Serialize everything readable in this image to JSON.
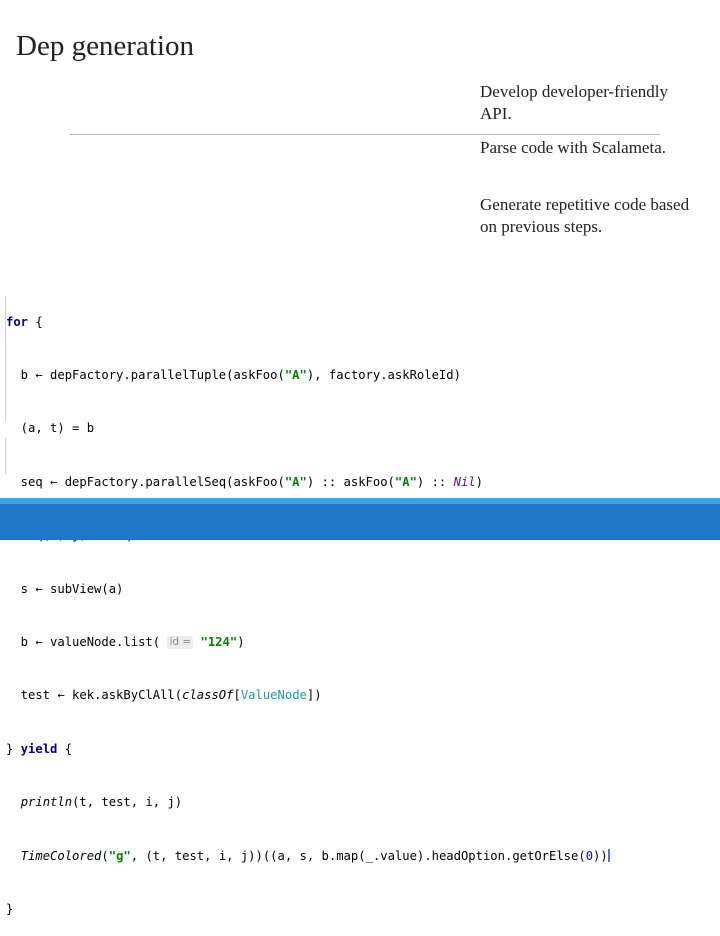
{
  "slide": {
    "title": "Dep generation",
    "bullets": [
      "Develop developer-friendly API.",
      "Parse code with Scalameta.",
      "Generate repetitive code based on previous steps."
    ]
  },
  "code": {
    "inlay_hint": "id =",
    "lines": [
      "for {",
      "  b ← depFactory.parallelTuple(askFoo(\"A\"), factory.askRoleId)",
      "  (a, t) = b",
      "  seq ← depFactory.parallelSeq(askFoo(\"A\") :: askFoo(\"A\") :: Nil)",
      "  Seq(i, j) = seq",
      "  s ← subView(a)",
      "  b ← valueNode.list(id = \"124\")",
      "  test ← kek.askByClAll(classOf[ValueNode])",
      "} yield {",
      "  println(t, test, i, j)",
      "  TimeColored(\"g\", (t, test, i, j))((a, s, b.map(_.value).headOption.getOrElse(0)))",
      "}"
    ]
  },
  "colors": {
    "keyword": "#000080",
    "string": "#008000",
    "number": "#0000ff",
    "footer": "#1d76c8",
    "footer_accent": "#3aa3e8"
  }
}
